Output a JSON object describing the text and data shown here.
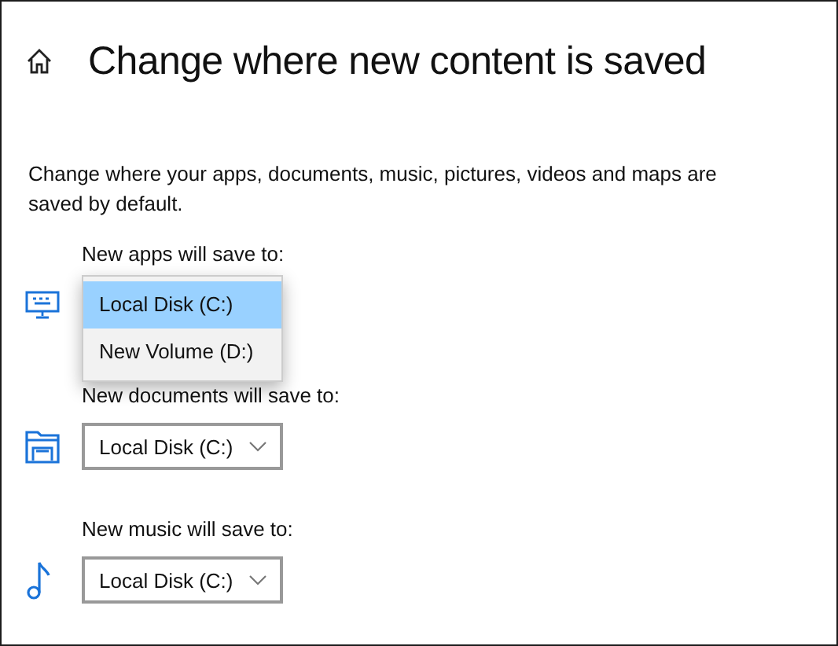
{
  "header": {
    "title": "Change where new content is saved"
  },
  "description": "Change where your apps, documents, music, pictures, videos and maps are saved by default.",
  "sections": [
    {
      "kind": "apps",
      "label": "New apps will save to:",
      "dropdown": {
        "expanded": true,
        "options": [
          {
            "label": "Local Disk (C:)",
            "selected": true
          },
          {
            "label": "New Volume (D:)",
            "selected": false
          }
        ]
      }
    },
    {
      "kind": "documents",
      "label": "New documents will save to:",
      "dropdown": {
        "expanded": false,
        "value": "Local Disk (C:)"
      }
    },
    {
      "kind": "music",
      "label": "New music will save to:",
      "dropdown": {
        "expanded": false,
        "value": "Local Disk (C:)"
      }
    }
  ]
}
